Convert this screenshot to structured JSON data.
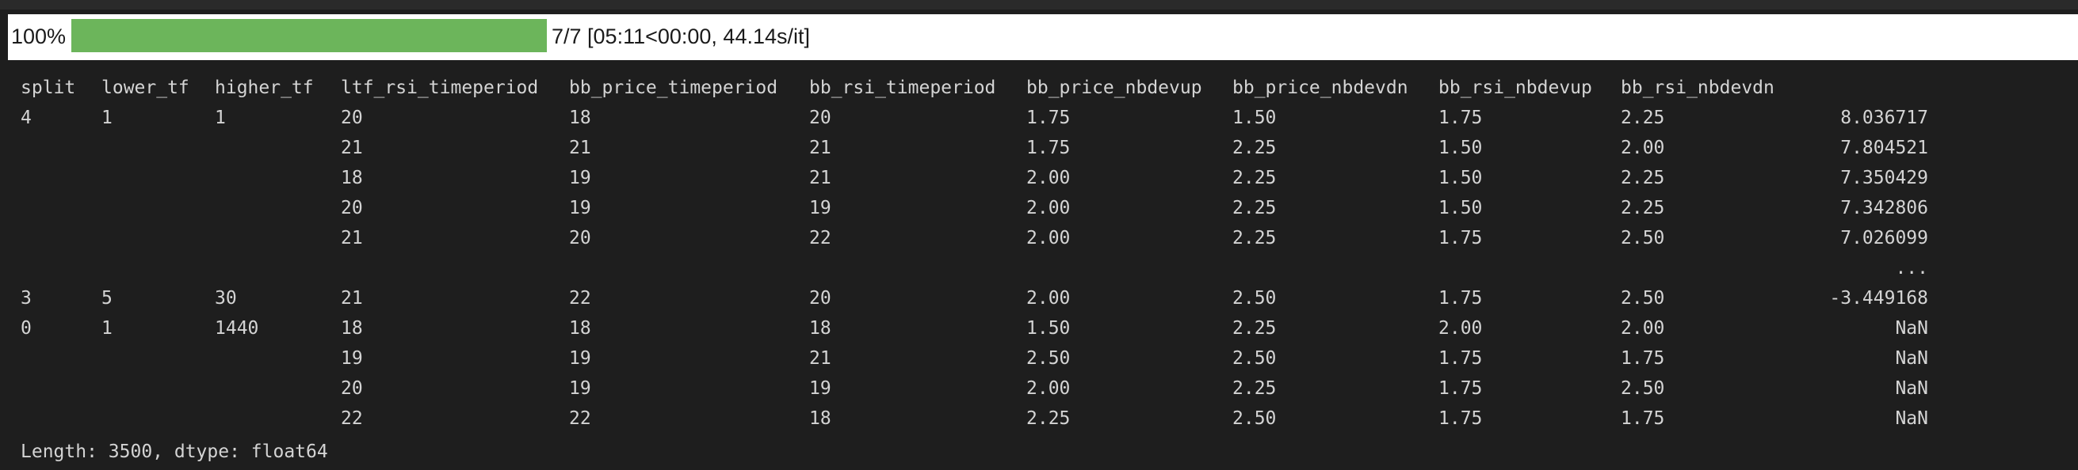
{
  "progress": {
    "percent_label": "100%",
    "fill_fraction": 1.0,
    "stats": "7/7 [05:11<00:00, 44.14s/it]",
    "colors": {
      "fill": "#6cb55b",
      "background": "#ffffff"
    }
  },
  "table": {
    "headers": {
      "split": "split",
      "lower_tf": "lower_tf",
      "higher_tf": "higher_tf",
      "ltf_rsi_timeperiod": "ltf_rsi_timeperiod",
      "bb_price_timeperiod": "bb_price_timeperiod",
      "bb_rsi_timeperiod": "bb_rsi_timeperiod",
      "bb_price_nbdevup": "bb_price_nbdevup",
      "bb_price_nbdevdn": "bb_price_nbdevdn",
      "bb_rsi_nbdevup": "bb_rsi_nbdevup",
      "bb_rsi_nbdevdn": "bb_rsi_nbdevdn",
      "value": ""
    },
    "rows": [
      {
        "split": "4",
        "lower_tf": "1",
        "higher_tf": "1",
        "ltf": "20",
        "bbp": "18",
        "bbr": "20",
        "bpu": "1.75",
        "bpd": "1.50",
        "bru": "1.75",
        "brd": "2.25",
        "value": "8.036717"
      },
      {
        "split": "",
        "lower_tf": "",
        "higher_tf": "",
        "ltf": "21",
        "bbp": "21",
        "bbr": "21",
        "bpu": "1.75",
        "bpd": "2.25",
        "bru": "1.50",
        "brd": "2.00",
        "value": "7.804521"
      },
      {
        "split": "",
        "lower_tf": "",
        "higher_tf": "",
        "ltf": "18",
        "bbp": "19",
        "bbr": "21",
        "bpu": "2.00",
        "bpd": "2.25",
        "bru": "1.50",
        "brd": "2.25",
        "value": "7.350429"
      },
      {
        "split": "",
        "lower_tf": "",
        "higher_tf": "",
        "ltf": "20",
        "bbp": "19",
        "bbr": "19",
        "bpu": "2.00",
        "bpd": "2.25",
        "bru": "1.50",
        "brd": "2.25",
        "value": "7.342806"
      },
      {
        "split": "",
        "lower_tf": "",
        "higher_tf": "",
        "ltf": "21",
        "bbp": "20",
        "bbr": "22",
        "bpu": "2.00",
        "bpd": "2.25",
        "bru": "1.75",
        "brd": "2.50",
        "value": "7.026099"
      },
      {
        "split": "",
        "lower_tf": "",
        "higher_tf": "",
        "ltf": "",
        "bbp": "",
        "bbr": "",
        "bpu": "",
        "bpd": "",
        "bru": "",
        "brd": "",
        "value": "..."
      },
      {
        "split": "3",
        "lower_tf": "5",
        "higher_tf": "30",
        "ltf": "21",
        "bbp": "22",
        "bbr": "20",
        "bpu": "2.00",
        "bpd": "2.50",
        "bru": "1.75",
        "brd": "2.50",
        "value": "-3.449168"
      },
      {
        "split": "0",
        "lower_tf": "1",
        "higher_tf": "1440",
        "ltf": "18",
        "bbp": "18",
        "bbr": "18",
        "bpu": "1.50",
        "bpd": "2.25",
        "bru": "2.00",
        "brd": "2.00",
        "value": "NaN"
      },
      {
        "split": "",
        "lower_tf": "",
        "higher_tf": "",
        "ltf": "19",
        "bbp": "19",
        "bbr": "21",
        "bpu": "2.50",
        "bpd": "2.50",
        "bru": "1.75",
        "brd": "1.75",
        "value": "NaN"
      },
      {
        "split": "",
        "lower_tf": "",
        "higher_tf": "",
        "ltf": "20",
        "bbp": "19",
        "bbr": "19",
        "bpu": "2.00",
        "bpd": "2.25",
        "bru": "1.75",
        "brd": "2.50",
        "value": "NaN"
      },
      {
        "split": "",
        "lower_tf": "",
        "higher_tf": "",
        "ltf": "22",
        "bbp": "22",
        "bbr": "18",
        "bpu": "2.25",
        "bpd": "2.50",
        "bru": "1.75",
        "brd": "1.75",
        "value": "NaN"
      }
    ]
  },
  "footer": "Length: 3500, dtype: float64"
}
